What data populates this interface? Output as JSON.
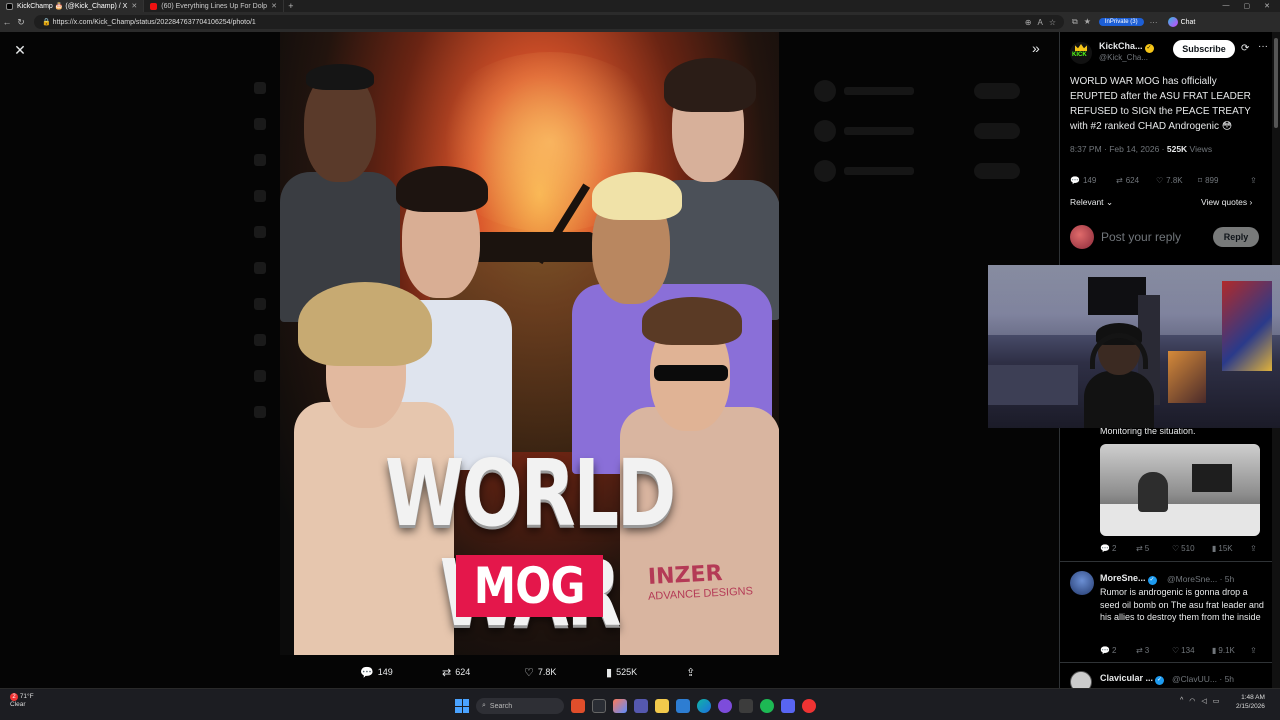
{
  "browser": {
    "tabs": [
      {
        "label": "KickChamp 🎂 (@Kick_Champ) / X",
        "active": true
      },
      {
        "label": "(60) Everything Lines Up For Dolp",
        "active": false
      }
    ],
    "url": "https://x.com/Kick_Champ/status/2022847637704106254/photo/1",
    "inprivate_label": "InPrivate (3)",
    "chat_label": "Chat"
  },
  "viewer": {
    "close_glyph": "✕",
    "expand_glyph": "»"
  },
  "poster": {
    "title": "WORLD WAR",
    "subtitle": "MOG",
    "brand_line1": "INZER",
    "brand_line2": "ADVANCE DESIGNS"
  },
  "poster_stats": {
    "replies": "149",
    "reposts": "624",
    "likes": "7.8K",
    "views": "525K"
  },
  "tweet": {
    "author_name": "KickCha...",
    "author_handle": "@Kick_Cha...",
    "subscribe_label": "Subscribe",
    "text": "WORLD WAR MOG has officially ERUPTED after the ASU FRAT LEADER REFUSED to SIGN the PEACE TREATY with #2 ranked CHAD Androgenic 😳",
    "time": "8:37 PM · Feb 14, 2026 · ",
    "views_count": "525K",
    "views_label": " Views",
    "replies": "149",
    "reposts": "624",
    "likes": "7.8K",
    "bookmarks": "899",
    "sort_label": "Relevant",
    "view_quotes_label": "View quotes",
    "reply_placeholder": "Post your reply",
    "reply_button": "Reply"
  },
  "replies": [
    {
      "text": "Monitoring the situation.",
      "replies": "2",
      "reposts": "5",
      "likes": "510",
      "views": "15K"
    },
    {
      "name": "MoreSne...",
      "handle": "@MoreSne...",
      "age": "· 5h",
      "text": "Rumor is androgenic is gonna drop a seed oil bomb on The asu frat leader and his allies to destroy them from the inside",
      "replies": "2",
      "reposts": "3",
      "likes": "134",
      "views": "9.1K"
    },
    {
      "name": "Clavicular ...",
      "handle": "@ClavUU...",
      "age": "· 5h"
    }
  ],
  "taskbar": {
    "weather_temp": "71°F",
    "weather_desc": "Clear",
    "search_placeholder": "Search",
    "time": "1:48 AM",
    "date": "2/15/2026"
  }
}
